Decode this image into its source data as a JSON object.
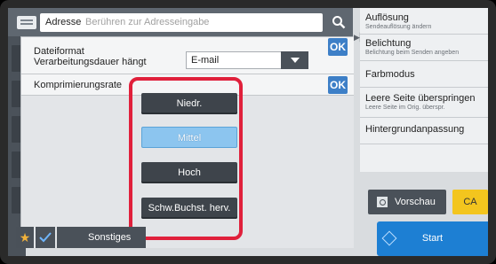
{
  "address_bar": {
    "label": "Adresse",
    "placeholder": "Berühren zur Adresseingabe"
  },
  "file_format_row": {
    "label_line1": "Dateiformat",
    "label_line2": "Verarbeitungsdauer hängt",
    "selected_value": "E-mail",
    "ok_label": "OK"
  },
  "compression_row": {
    "label": "Komprimierungsrate",
    "ok_label": "OK"
  },
  "compression_options": [
    {
      "label": "Niedr.",
      "selected": false
    },
    {
      "label": "Mittel",
      "selected": true
    },
    {
      "label": "Hoch",
      "selected": false
    },
    {
      "label": "Schw.Buchst. herv.",
      "selected": false
    }
  ],
  "bottom_bar": {
    "other_label": "Sonstiges"
  },
  "right_panel": {
    "items": [
      {
        "title": "Auflösung",
        "subtitle": "Sendeauflösung ändern"
      },
      {
        "title": "Belichtung",
        "subtitle": "Belichtung beim Senden angeben"
      },
      {
        "title": "Farbmodus",
        "subtitle": ""
      },
      {
        "title": "Leere Seite überspringen",
        "subtitle": "Leere Seite im Orig. überspr."
      },
      {
        "title": "Hintergrundanpassung",
        "subtitle": ""
      }
    ]
  },
  "actions": {
    "preview_label": "Vorschau",
    "ca_label": "CA",
    "start_label": "Start"
  },
  "colors": {
    "highlight_frame": "#e0203b",
    "selected_option": "#8cc5ef",
    "ok_button": "#3d7fc7",
    "start_button": "#1d7fd3",
    "ca_button": "#f3c51e"
  }
}
